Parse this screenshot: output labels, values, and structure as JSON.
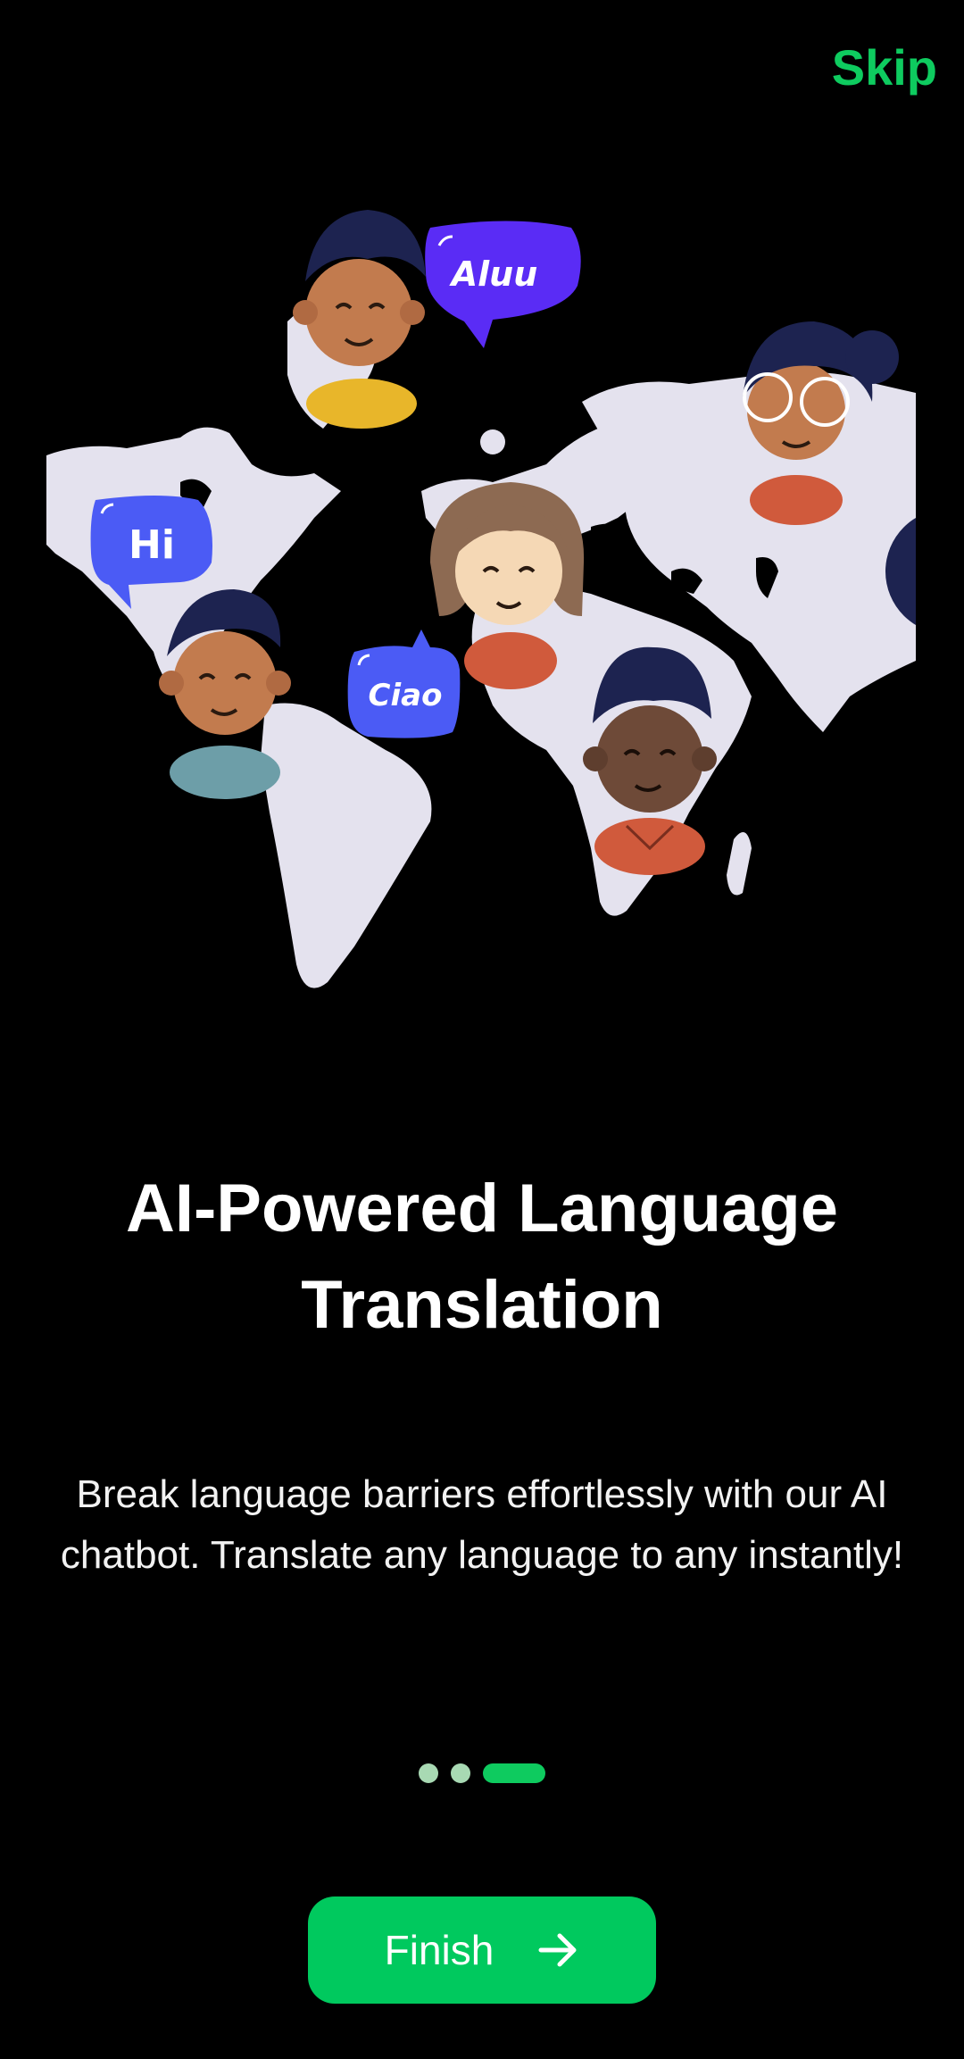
{
  "header": {
    "skip_label": "Skip"
  },
  "illustration": {
    "bubbles": {
      "top": "Aluu",
      "left": "Hi",
      "middle": "Ciao"
    }
  },
  "content": {
    "title": "AI-Powered Language Translation",
    "description": "Break language barriers effortlessly with our AI chatbot. Translate any language to any instantly!"
  },
  "pagination": {
    "total": 3,
    "current": 3
  },
  "footer": {
    "finish_label": "Finish",
    "finish_icon": "arrow-right-icon"
  },
  "colors": {
    "accent": "#0ecb5f",
    "button": "#00c95e",
    "dot_inactive": "#a8d9b3",
    "background": "#000000"
  }
}
